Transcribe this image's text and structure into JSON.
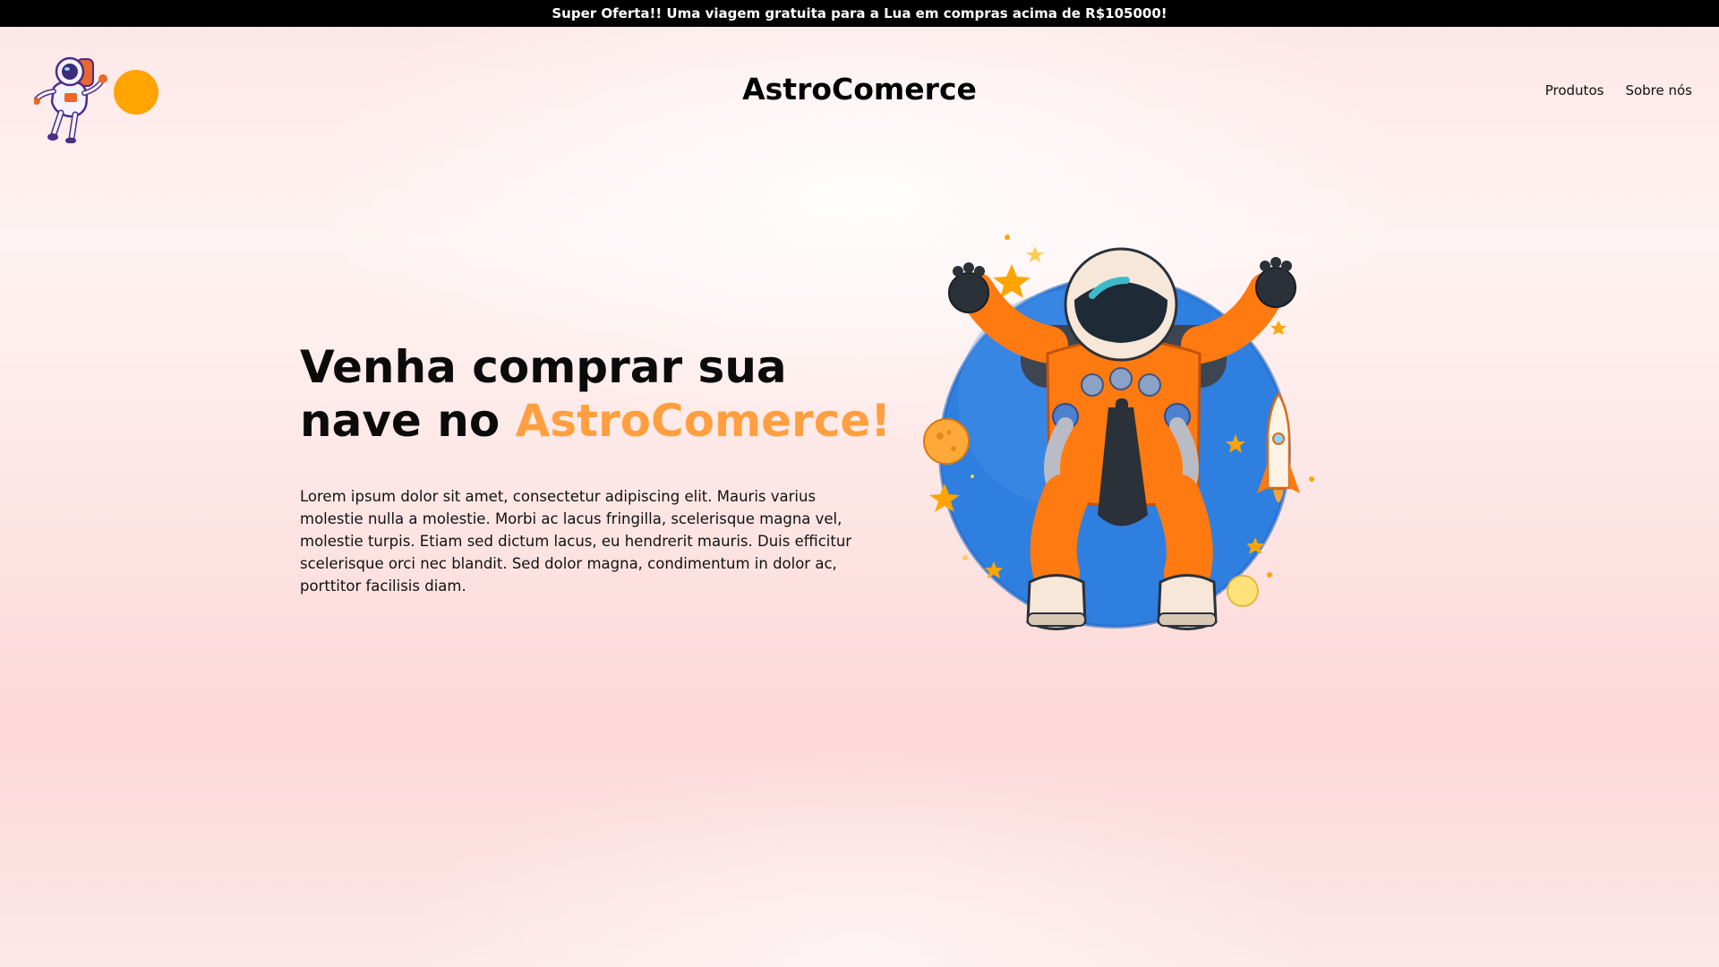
{
  "promo": {
    "text": "Super Oferta!! Uma viagem gratuita para a Lua em compras acima de R$105000!"
  },
  "header": {
    "logo_icon": "astronaut-icon",
    "brand": "AstroComerce",
    "nav": [
      {
        "label": "Produtos"
      },
      {
        "label": "Sobre nós"
      }
    ]
  },
  "hero": {
    "title_part1": "Venha comprar sua nave no ",
    "title_accent": "AstroComerce!",
    "paragraph": "Lorem ipsum dolor sit amet, consectetur adipiscing elit. Mauris varius molestie nulla a molestie. Morbi ac lacus fringilla, scelerisque magna vel, molestie turpis. Etiam sed dictum lacus, eu hendrerit mauris. Duis efficitur scelerisque orci nec blandit. Sed dolor magna, condimentum in dolor ac, porttitor facilisis diam.",
    "illustration": "astronaut-illustration"
  },
  "colors": {
    "accent": "#ff9f3f",
    "logo_dot": "#ffa400",
    "promo_bg": "#000000",
    "planet_blue": "#2f7fe0",
    "suit_orange": "#ff7a10"
  }
}
